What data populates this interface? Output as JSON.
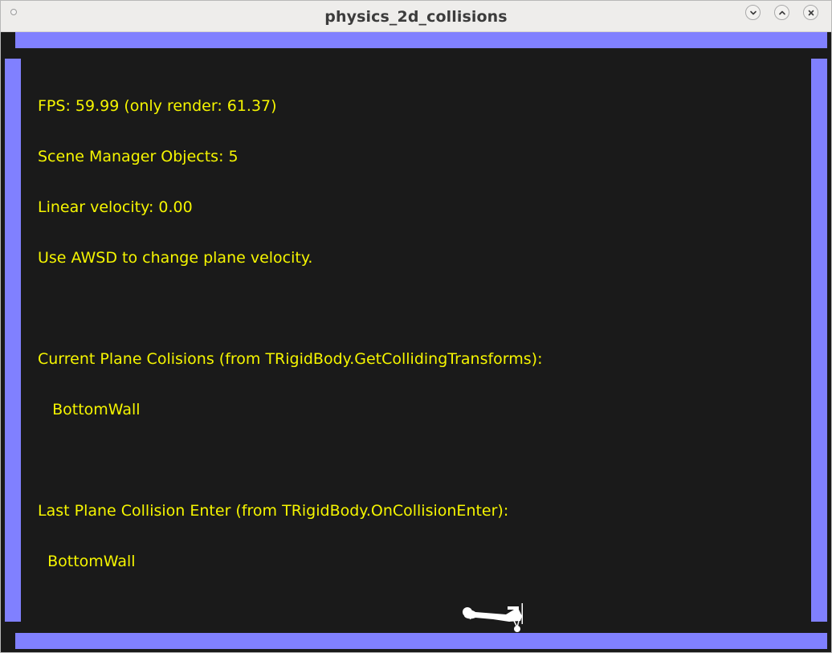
{
  "window": {
    "title": "physics_2d_collisions"
  },
  "hud": {
    "fps_line": "FPS: 59.99 (only render: 61.37)",
    "objects_line": "Scene Manager Objects: 5",
    "velocity_line": "Linear velocity: 0.00",
    "hint_line": "Use AWSD to change plane velocity.",
    "current_header": "Current Plane Colisions (from TRigidBody.GetCollidingTransforms):",
    "current_value": "   BottomWall",
    "last_header": "Last Plane Collision Enter (from TRigidBody.OnCollisionEnter):",
    "last_value": "  BottomWall"
  },
  "colors": {
    "background": "#1a1a1a",
    "wall": "#8080ff",
    "text": "#f5f500",
    "plane": "#ffffff"
  },
  "icons": {
    "menu": "menu-dot-icon",
    "minimize": "chevron-down-icon",
    "maximize": "chevron-up-icon",
    "close": "close-icon"
  }
}
